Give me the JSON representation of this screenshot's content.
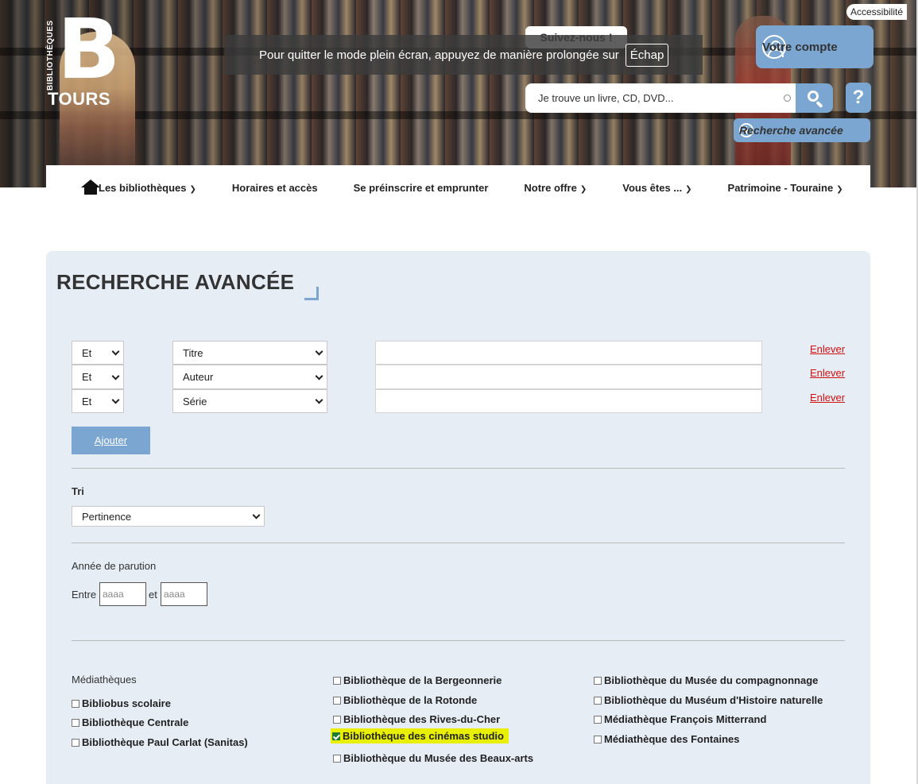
{
  "header": {
    "logo": {
      "vertical_text": "BIBLIOTHÈQUES",
      "letter": "B",
      "city": "TOURS"
    },
    "accessibility_label": "Accessibilité",
    "follow_label": "Suivez-nous !",
    "fullscreen_notice": {
      "message": "Pour quitter le mode plein écran, appuyez de manière prolongée sur",
      "key": "Échap"
    },
    "account_label": "Votre compte",
    "search": {
      "placeholder": "Je trouve un livre, CD, DVD..."
    },
    "help_label": "?",
    "advanced_search_label": "Recherche avancée"
  },
  "nav": {
    "items": [
      {
        "label": "Les bibliothèques",
        "chevron": true
      },
      {
        "label": "Horaires et accès",
        "chevron": false
      },
      {
        "label": "Se préinscrire et emprunter",
        "chevron": false
      },
      {
        "label": "Notre offre",
        "chevron": true
      },
      {
        "label": "Vous êtes ...",
        "chevron": true
      },
      {
        "label": "Patrimoine - Touraine",
        "chevron": true
      }
    ]
  },
  "form": {
    "title": "RECHERCHE AVANCÉE",
    "criteria": [
      {
        "operator": "Et",
        "field": "Titre",
        "value": "",
        "remove_label": "Enlever"
      },
      {
        "operator": "Et",
        "field": "Auteur",
        "value": "",
        "remove_label": "Enlever"
      },
      {
        "operator": "Et",
        "field": "Série",
        "value": "",
        "remove_label": "Enlever"
      }
    ],
    "add_label": "Ajouter",
    "sort": {
      "label": "Tri",
      "value": "Pertinence"
    },
    "year": {
      "label": "Année de parution",
      "between": "Entre",
      "and": "et",
      "from_placeholder": "aaaa",
      "to_placeholder": "aaaa"
    },
    "libraries": {
      "label": "Médiathèques",
      "col1": [
        {
          "label": "Bibliobus scolaire",
          "checked": false
        },
        {
          "label": "Bibliothèque Centrale",
          "checked": false
        },
        {
          "label": "Bibliothèque Paul Carlat (Sanitas)",
          "checked": false
        }
      ],
      "col2": [
        {
          "label": "Bibliothèque de la Bergeonnerie",
          "checked": false
        },
        {
          "label": "Bibliothèque de la Rotonde",
          "checked": false
        },
        {
          "label": "Bibliothèque des Rives-du-Cher",
          "checked": false
        },
        {
          "label": "Bibliothèque des cinémas studio",
          "checked": true
        },
        {
          "label": "Bibliothèque du Musée des Beaux-arts",
          "checked": false
        }
      ],
      "col3": [
        {
          "label": "Bibliothèque du Musée du compagnonnage",
          "checked": false
        },
        {
          "label": "Bibliothèque du Muséum d'Histoire naturelle",
          "checked": false
        },
        {
          "label": "Médiathèque François Mitterrand",
          "checked": false
        },
        {
          "label": "Médiathèque des Fontaines",
          "checked": false
        }
      ]
    }
  },
  "colors": {
    "accent": "#7ba6d1",
    "panel_bg": "#e6edf5",
    "remove_link": "#d01010",
    "highlight": "#e8f000"
  }
}
